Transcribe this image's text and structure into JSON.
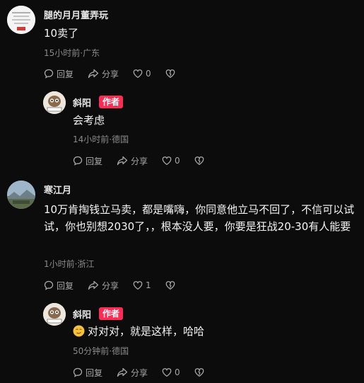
{
  "colors": {
    "background": "#0c0c0c",
    "author_badge": "#fe2c55",
    "meta_text": "#8a8a8a"
  },
  "icons": {
    "reply": "reply-bubble-icon",
    "share": "share-arrow-icon",
    "like": "heart-icon",
    "dislike": "broken-heart-icon",
    "emoji": "smirk-emoji-icon"
  },
  "comments": [
    {
      "username": "腿的月月董弄玩",
      "text": "10卖了",
      "meta": "15小时前·广东",
      "reply_label": "回复",
      "share_label": "分享",
      "likes": "0",
      "replies": [
        {
          "username": "斜阳",
          "badge": "作者",
          "text": "会考虑",
          "meta": "14小时前·德国",
          "reply_label": "回复",
          "share_label": "分享",
          "likes": "0"
        }
      ]
    },
    {
      "username": "寒江月",
      "text": "10万肯掏钱立马卖，都是嘴嗨，你同意他立马不回了，不信可以试试，你也别想2030了，，根本没人要，你要是狂战20-30有人能要",
      "meta": "1小时前·浙江",
      "reply_label": "回复",
      "share_label": "分享",
      "likes": "1",
      "replies": [
        {
          "username": "斜阳",
          "badge": "作者",
          "text": "对对对，就是这样，哈哈",
          "meta": "50分钟前·德国",
          "reply_label": "回复",
          "share_label": "分享",
          "likes": "0"
        }
      ]
    }
  ]
}
